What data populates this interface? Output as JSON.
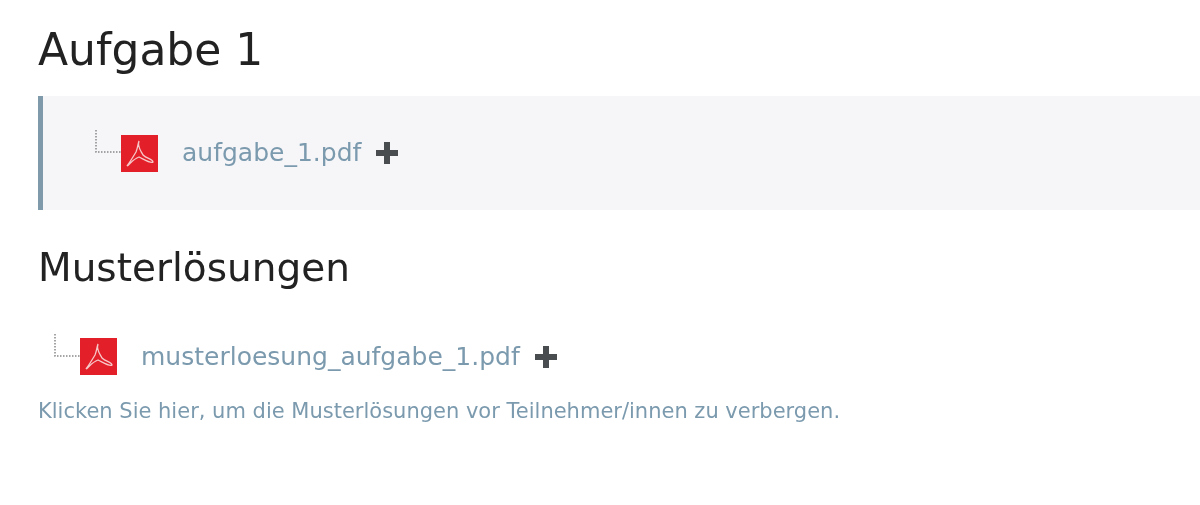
{
  "sections": [
    {
      "title": "Aufgabe 1",
      "boxed": true,
      "files": [
        {
          "name": "aufgabe_1.pdf"
        }
      ]
    },
    {
      "title": "Musterlösungen",
      "boxed": false,
      "files": [
        {
          "name": "musterloesung_aufgabe_1.pdf"
        }
      ],
      "toggle_link": "Klicken Sie hier, um die Musterlösungen vor Teilnehmer/innen zu verbergen."
    }
  ]
}
